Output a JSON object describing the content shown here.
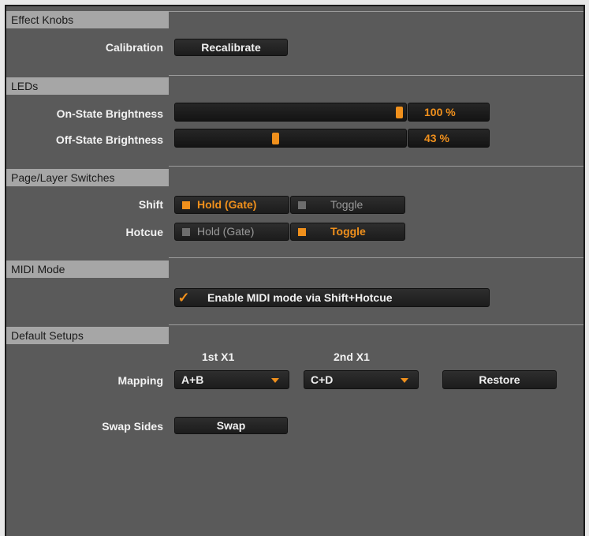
{
  "sections": {
    "effect_knobs": {
      "header": "Effect Knobs",
      "calibration_label": "Calibration",
      "recalibrate_button": "Recalibrate"
    },
    "leds": {
      "header": "LEDs",
      "on_state": {
        "label": "On-State Brightness",
        "value_text": "100 %",
        "fraction": 1.0
      },
      "off_state": {
        "label": "Off-State Brightness",
        "value_text": "43 %",
        "fraction": 0.43
      }
    },
    "page_layer": {
      "header": "Page/Layer Switches",
      "shift": {
        "label": "Shift",
        "option1": "Hold (Gate)",
        "option2": "Toggle",
        "selected": "Hold (Gate)"
      },
      "hotcue": {
        "label": "Hotcue",
        "option1": "Hold (Gate)",
        "option2": "Toggle",
        "selected": "Toggle"
      }
    },
    "midi_mode": {
      "header": "MIDI Mode",
      "enable_checkbox": {
        "label": "Enable MIDI mode via Shift+Hotcue",
        "checked": true,
        "check_glyph": "✓"
      }
    },
    "default_setups": {
      "header": "Default Setups",
      "col1_header": "1st X1",
      "col2_header": "2nd X1",
      "mapping_label": "Mapping",
      "mapping1_value": "A+B",
      "mapping2_value": "C+D",
      "restore_button": "Restore",
      "swap_label": "Swap Sides",
      "swap_button": "Swap"
    }
  },
  "colors": {
    "panel_bg": "#5a5a5a",
    "header_bg": "#a6a6a6",
    "accent": "#f0901c",
    "button_bg": "#222222"
  },
  "icons": {
    "dropdown_arrow": "chevron-down-icon",
    "checkmark": "check-icon"
  }
}
